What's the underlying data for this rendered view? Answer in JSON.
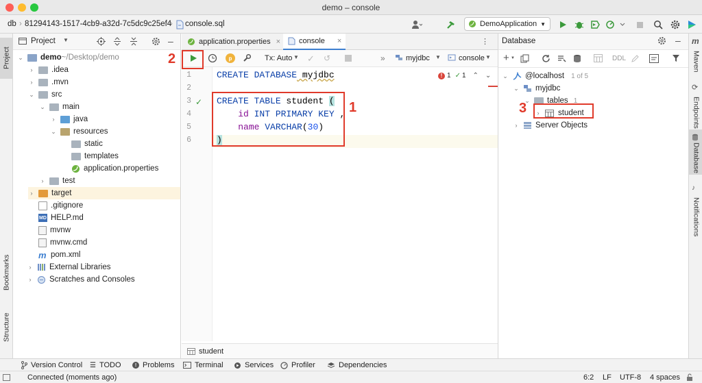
{
  "window": {
    "title": "demo – console"
  },
  "toolbar": {
    "crumb_root": "db",
    "crumb_id": "81294143-1517-4cb9-a32d-7c5dc9c25ef4",
    "crumb_file": "console.sql",
    "run_config": "DemoApplication"
  },
  "left_stripe": {
    "project": "Project",
    "bookmarks": "Bookmarks",
    "structure": "Structure"
  },
  "project": {
    "header": "Project",
    "tree": [
      {
        "label": "demo",
        "suffix": " ~/Desktop/demo"
      },
      {
        "label": ".idea"
      },
      {
        "label": ".mvn"
      },
      {
        "label": "src"
      },
      {
        "label": "main"
      },
      {
        "label": "java"
      },
      {
        "label": "resources"
      },
      {
        "label": "static"
      },
      {
        "label": "templates"
      },
      {
        "label": "application.properties"
      },
      {
        "label": "test"
      },
      {
        "label": "target"
      },
      {
        "label": ".gitignore"
      },
      {
        "label": "HELP.md"
      },
      {
        "label": "mvnw"
      },
      {
        "label": "mvnw.cmd"
      },
      {
        "label": "pom.xml"
      },
      {
        "label": "External Libraries"
      },
      {
        "label": "Scratches and Consoles"
      }
    ]
  },
  "editor": {
    "tabs": [
      {
        "label": "application.properties"
      },
      {
        "label": "console"
      }
    ],
    "tx_mode": "Tx: Auto",
    "schema": "myjdbc",
    "session": "console",
    "warnings": "1",
    "checks": "1",
    "line_numbers": [
      "1",
      "2",
      "3",
      "4",
      "5",
      "6"
    ],
    "footer": "student"
  },
  "code": {
    "l1_kw": "CREATE DATABASE",
    "l1_id": " myjdbc",
    "l3_kw": "CREATE TABLE",
    "l3_id": " student ",
    "l3_paren": "(",
    "l4_id": "id",
    "l4_kw": " INT PRIMARY KEY",
    "l4_comma": " ,",
    "l5_id": "name",
    "l5_kw": " VARCHAR",
    "l5_open": "(",
    "l5_num": "30",
    "l5_close": ")",
    "l6": ")"
  },
  "database": {
    "header": "Database",
    "ddl": "DDL",
    "host": "@localhost",
    "host_count": "1 of 5",
    "schema": "myjdbc",
    "tables": "tables",
    "tables_count": "1",
    "table": "student",
    "server_objects": "Server Objects"
  },
  "right_stripe": {
    "maven": "Maven",
    "endpoints": "Endpoints",
    "database": "Database",
    "notifications": "Notifications"
  },
  "bottom_tabs": [
    "Version Control",
    "TODO",
    "Problems",
    "Terminal",
    "Services",
    "Profiler",
    "Dependencies"
  ],
  "status": {
    "message": "Connected (moments ago)",
    "position": "6:2",
    "line_sep": "LF",
    "encoding": "UTF-8",
    "indent": "4 spaces"
  },
  "annotations": [
    "1",
    "2",
    "3"
  ],
  "colors": {
    "annotation": "#e03a2a",
    "run_green": "#3c9a3c",
    "keyword": "#0a3fa8"
  }
}
